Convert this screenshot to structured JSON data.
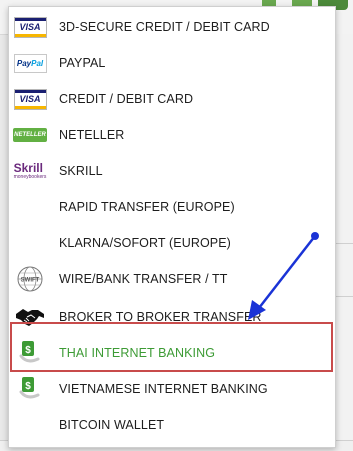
{
  "background": {
    "bottom_bar_texts": [
      "...",
      "...",
      "+",
      "..."
    ]
  },
  "menu": {
    "items": [
      {
        "label": "3D-SECURE CREDIT / DEBIT CARD",
        "icon": "visa-card-icon",
        "logo_text": "VISA"
      },
      {
        "label": "PAYPAL",
        "icon": "paypal-icon",
        "logo_text": "PayPal"
      },
      {
        "label": "CREDIT / DEBIT CARD",
        "icon": "visa-card-icon",
        "logo_text": "VISA"
      },
      {
        "label": "NETELLER",
        "icon": "neteller-icon",
        "logo_text": "NETELLER"
      },
      {
        "label": "SKRILL",
        "icon": "skrill-icon",
        "logo_text": "Skrill",
        "logo_subtext": "moneybookers"
      },
      {
        "label": "RAPID TRANSFER (EUROPE)",
        "icon": ""
      },
      {
        "label": "KLARNA/SOFORT (EUROPE)",
        "icon": ""
      },
      {
        "label": "WIRE/BANK TRANSFER / TT",
        "icon": "swift-icon",
        "logo_text": "SWIFT"
      },
      {
        "label": "BROKER TO BROKER TRANSFER",
        "icon": "handshake-icon"
      },
      {
        "label": "THAI INTERNET BANKING",
        "icon": "money-hand-icon",
        "selected": true
      },
      {
        "label": "VIETNAMESE INTERNET BANKING",
        "icon": "money-hand-icon"
      },
      {
        "label": "BITCOIN WALLET",
        "icon": ""
      }
    ],
    "selected_index": 9
  },
  "colors": {
    "selected_text": "#3d9b35",
    "highlight_border": "#c84b4b",
    "annotation_arrow": "#1a33d6"
  }
}
